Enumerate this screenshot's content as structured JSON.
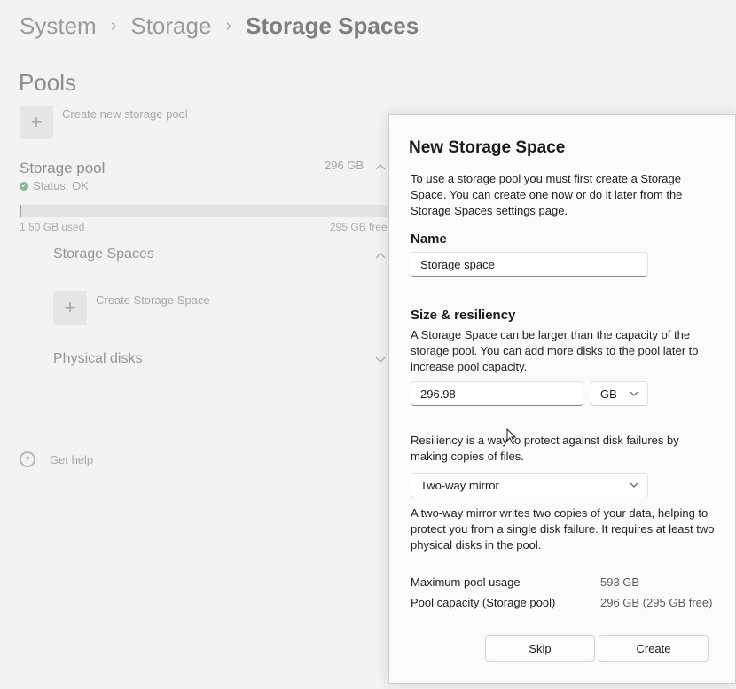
{
  "breadcrumb": {
    "items": [
      "System",
      "Storage"
    ],
    "current": "Storage Spaces",
    "separator": "›"
  },
  "pools": {
    "title": "Pools",
    "create_pool_label": "Create new storage pool",
    "plus_glyph": "+",
    "pool": {
      "name": "Storage pool",
      "size": "296 GB",
      "status": "Status: OK",
      "used": "1.50 GB used",
      "free": "295 GB free",
      "usage_fraction": 0.005
    },
    "storage_spaces_label": "Storage Spaces",
    "create_space_label": "Create Storage Space",
    "physical_disks_label": "Physical disks"
  },
  "help": {
    "label": "Get help"
  },
  "dialog": {
    "title": "New Storage Space",
    "intro": "To use a storage pool you must first create a Storage Space. You can create one now or do it later from the Storage Spaces settings page.",
    "name_heading": "Name",
    "name_value": "Storage space",
    "size_heading": "Size & resiliency",
    "size_text": "A Storage Space can be larger than the capacity of the storage pool. You can add more disks to the pool later to increase pool capacity.",
    "size_value": "296.98",
    "size_unit": "GB",
    "resiliency_text": "Resiliency is a way to protect against disk failures by making copies of files.",
    "resiliency_value": "Two-way mirror",
    "mirror_text": "A two-way mirror writes two copies of your data, helping to protect you from a single disk failure. It requires at least two physical disks in the pool.",
    "max_usage_label": "Maximum pool usage",
    "max_usage_value": "593 GB",
    "capacity_label": "Pool capacity (Storage pool)",
    "capacity_value": "296 GB (295 GB free)",
    "skip_label": "Skip",
    "create_label": "Create"
  },
  "colors": {
    "accent": "#9aa3ad",
    "status_ok": "#8fb59a",
    "dialog_bg": "#fbfbfb"
  }
}
